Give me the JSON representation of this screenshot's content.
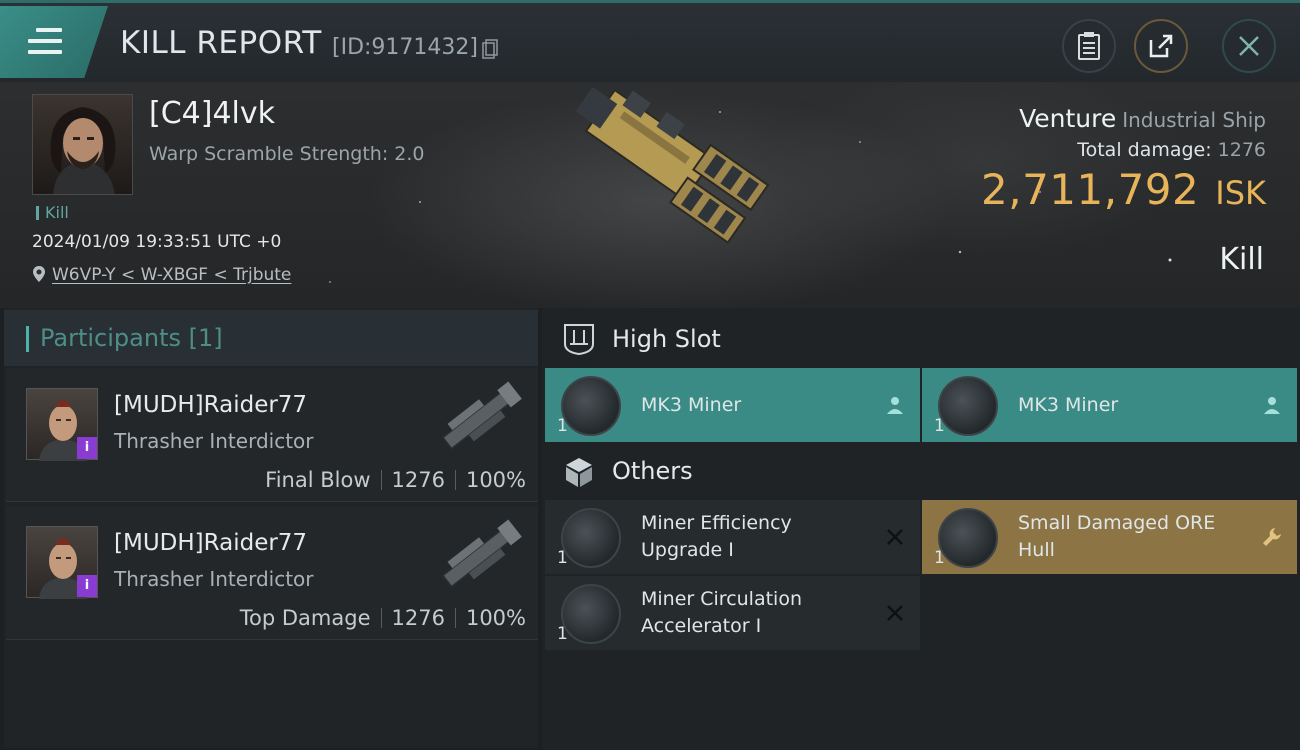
{
  "header": {
    "title": "KILL REPORT",
    "report_id": "[ID:9171432]",
    "buttons": [
      "clipboard",
      "share",
      "close"
    ]
  },
  "victim": {
    "pilot_name": "[C4]4lvk",
    "warp_scramble": "Warp Scramble Strength: 2.0",
    "tag": "Kill",
    "datetime": "2024/01/09 19:33:51 UTC +0",
    "location": "W6VP-Y < W-XBGF < Trjbute",
    "ship_name": "Venture",
    "ship_class": "Industrial Ship",
    "total_damage_label": "Total damage:",
    "total_damage": "1276",
    "isk_value": "2,711,792",
    "isk_unit": "ISK",
    "result": "Kill"
  },
  "participants": {
    "header": "Participants [1]",
    "items": [
      {
        "name": "[MUDH]Raider77",
        "ship": "Thrasher Interdictor",
        "role": "Final Blow",
        "damage": "1276",
        "percent": "100%",
        "badge": "i"
      },
      {
        "name": "[MUDH]Raider77",
        "ship": "Thrasher Interdictor",
        "role": "Top Damage",
        "damage": "1276",
        "percent": "100%",
        "badge": "i"
      }
    ]
  },
  "fitting": {
    "high_slot": {
      "title": "High Slot",
      "items": [
        {
          "name": "MK3 Miner",
          "qty": "1"
        },
        {
          "name": "MK3 Miner",
          "qty": "1"
        }
      ]
    },
    "others": {
      "title": "Others",
      "items": [
        {
          "name_line1": "Miner Efficiency",
          "name_line2": "Upgrade I",
          "qty": "1",
          "state": "destroyed"
        },
        {
          "name_line1": "Small Damaged ORE",
          "name_line2": "Hull",
          "qty": "1",
          "state": "dropped"
        },
        {
          "name_line1": "Miner Circulation",
          "name_line2": "Accelerator I",
          "qty": "1",
          "state": "destroyed"
        }
      ]
    }
  },
  "colors": {
    "accent_teal": "#3a8b85",
    "isk_gold": "#e8b45a",
    "dropped_gold": "#8c7444",
    "badge_purple": "#8a3bd1"
  }
}
